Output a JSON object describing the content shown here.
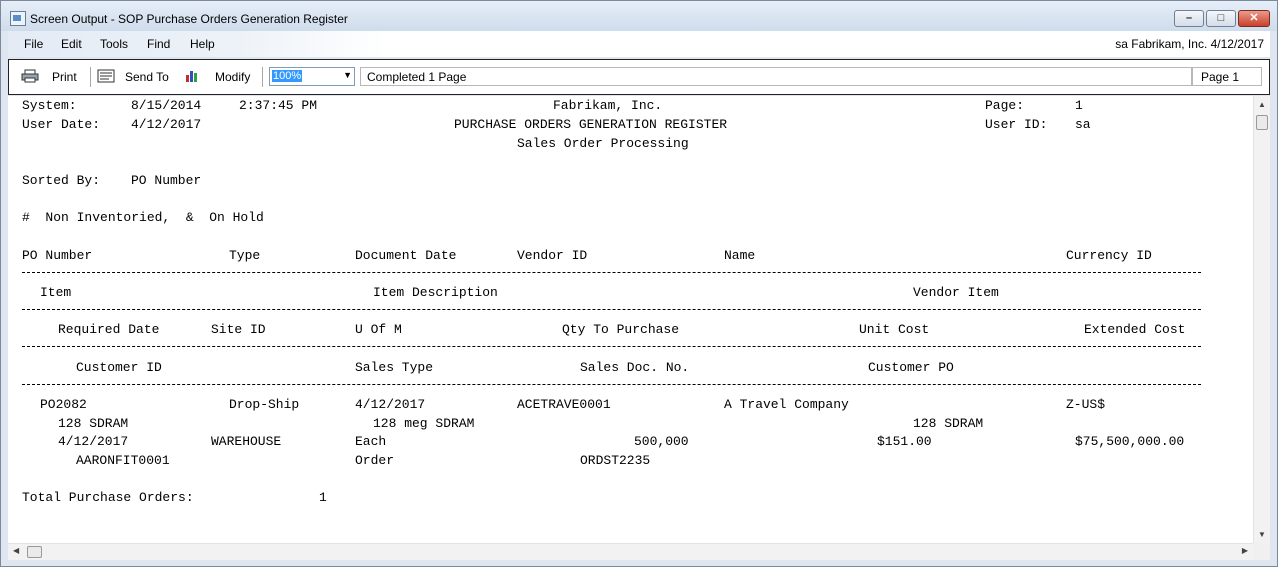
{
  "window": {
    "title": "Screen Output - SOP Purchase Orders Generation Register"
  },
  "menu": {
    "items": [
      "File",
      "Edit",
      "Tools",
      "Find",
      "Help"
    ],
    "user_info": "sa  Fabrikam, Inc.  4/12/2017"
  },
  "toolbar": {
    "print_label": "Print",
    "sendto_label": "Send To",
    "modify_label": "Modify",
    "zoom_value": "100%",
    "status": "Completed 1 Page",
    "page": "Page 1"
  },
  "report": {
    "header": {
      "system_label": "System:",
      "system_date": "8/15/2014",
      "system_time": "2:37:45 PM",
      "company": "Fabrikam, Inc.",
      "page_label": "Page:",
      "page_num": "1",
      "user_date_label": "User Date:",
      "user_date": "4/12/2017",
      "title": "PURCHASE ORDERS GENERATION REGISTER",
      "user_id_label": "User ID:",
      "user_id": "sa",
      "subtitle": "Sales Order Processing"
    },
    "sorted_by_label": "Sorted By:",
    "sorted_by": "PO Number",
    "legend": "#  Non Inventoried,  &  On Hold",
    "col_headers": {
      "row1": [
        "PO Number",
        "Type",
        "Document Date",
        "Vendor ID",
        "Name",
        "Currency ID"
      ],
      "row2": [
        "Item",
        "Item Description",
        "Vendor Item"
      ],
      "row3": [
        "Required Date",
        "Site ID",
        "U Of M",
        "Qty To Purchase",
        "Unit Cost",
        "Extended Cost"
      ],
      "row4": [
        "Customer ID",
        "Sales Type",
        "Sales Doc. No.",
        "Customer PO"
      ]
    },
    "record": {
      "po_number": "PO2082",
      "type": "Drop-Ship",
      "document_date": "4/12/2017",
      "vendor_id": "ACETRAVE0001",
      "name": "A Travel Company",
      "currency_id": "Z-US$",
      "item": "128 SDRAM",
      "item_description": "128 meg SDRAM",
      "vendor_item": "128 SDRAM",
      "required_date": "4/12/2017",
      "site_id": "WAREHOUSE",
      "uofm": "Each",
      "qty": "500,000",
      "unit_cost": "$151.00",
      "extended_cost": "$75,500,000.00",
      "customer_id": "AARONFIT0001",
      "sales_type": "Order",
      "sales_doc_no": "ORDST2235"
    },
    "total_label": "Total Purchase Orders:",
    "total_value": "1"
  }
}
